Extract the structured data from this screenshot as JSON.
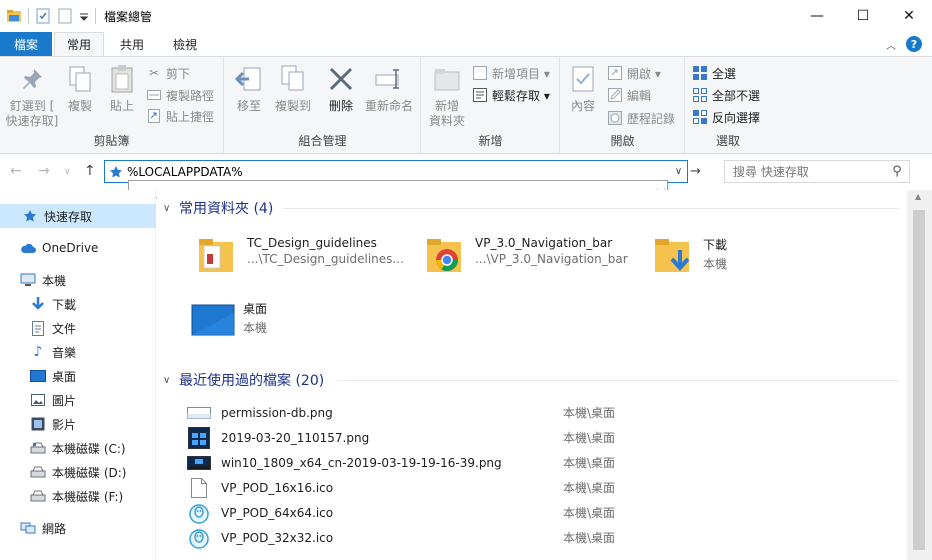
{
  "window": {
    "title": "檔案總管",
    "controls": {
      "minimize": "—",
      "maximize": "☐",
      "close": "✕"
    }
  },
  "ribbon_tabs": {
    "file": "檔案",
    "home": "常用",
    "share": "共用",
    "view": "檢視"
  },
  "ribbon": {
    "clipboard": {
      "label": "剪貼簿",
      "pin": "釘選到 [\n快速存取]",
      "copy": "複製",
      "paste": "貼上",
      "cut": "剪下",
      "copy_path": "複製路徑",
      "paste_shortcut": "貼上捷徑"
    },
    "organize": {
      "label": "組合管理",
      "move_to": "移至",
      "copy_to": "複製到",
      "delete": "刪除",
      "rename": "重新命名"
    },
    "new": {
      "label": "新增",
      "new_folder": "新增\n資料夾",
      "new_item": "新增項目 ▾",
      "easy_access": "輕鬆存取 ▾"
    },
    "open": {
      "label": "開啟",
      "properties": "內容",
      "open": "開啟 ▾",
      "edit": "編輯",
      "history": "歷程記錄"
    },
    "select": {
      "label": "選取",
      "select_all": "全選",
      "select_none": "全部不選",
      "invert": "反向選擇"
    }
  },
  "addressbar": {
    "value": "%LOCALAPPDATA%",
    "search_placeholder": "搜尋 快速存取"
  },
  "navpane": {
    "items": [
      {
        "label": "快速存取",
        "icon": "star-icon"
      },
      {
        "label": "OneDrive",
        "icon": "cloud-icon"
      },
      {
        "label": "本機",
        "icon": "computer-icon"
      },
      {
        "label": "下載",
        "icon": "download-icon"
      },
      {
        "label": "文件",
        "icon": "document-icon"
      },
      {
        "label": "音樂",
        "icon": "music-icon"
      },
      {
        "label": "桌面",
        "icon": "desktop-icon"
      },
      {
        "label": "圖片",
        "icon": "pictures-icon"
      },
      {
        "label": "影片",
        "icon": "videos-icon"
      },
      {
        "label": "本機磁碟 (C:)",
        "icon": "drive-icon"
      },
      {
        "label": "本機磁碟 (D:)",
        "icon": "drive-icon"
      },
      {
        "label": "本機磁碟 (F:)",
        "icon": "drive-icon"
      },
      {
        "label": "網路",
        "icon": "network-icon"
      }
    ]
  },
  "frequent": {
    "title": "常用資料夾 (4)",
    "items": [
      {
        "name": "TC_Design_guidelines",
        "sub": "...\\TC_Design_guidelines..."
      },
      {
        "name": "VP_3.0_Navigation_bar",
        "sub": "...\\VP_3.0_Navigation_bar"
      },
      {
        "name": "下載",
        "sub": "本機"
      },
      {
        "name": "桌面",
        "sub": "本機"
      }
    ]
  },
  "recent": {
    "title": "最近使用過的檔案 (20)",
    "items": [
      {
        "name": "permission-db.png",
        "location": "本機\\桌面"
      },
      {
        "name": "2019-03-20_110157.png",
        "location": "本機\\桌面"
      },
      {
        "name": "win10_1809_x64_cn-2019-03-19-19-16-39.png",
        "location": "本機\\桌面"
      },
      {
        "name": "VP_POD_16x16.ico",
        "location": "本機\\桌面"
      },
      {
        "name": "VP_POD_64x64.ico",
        "location": "本機\\桌面"
      },
      {
        "name": "VP_POD_32x32.ico",
        "location": "本機\\桌面"
      }
    ]
  },
  "colors": {
    "accent": "#1979ca",
    "selection": "#cce8ff",
    "section_title": "#1e3287"
  }
}
